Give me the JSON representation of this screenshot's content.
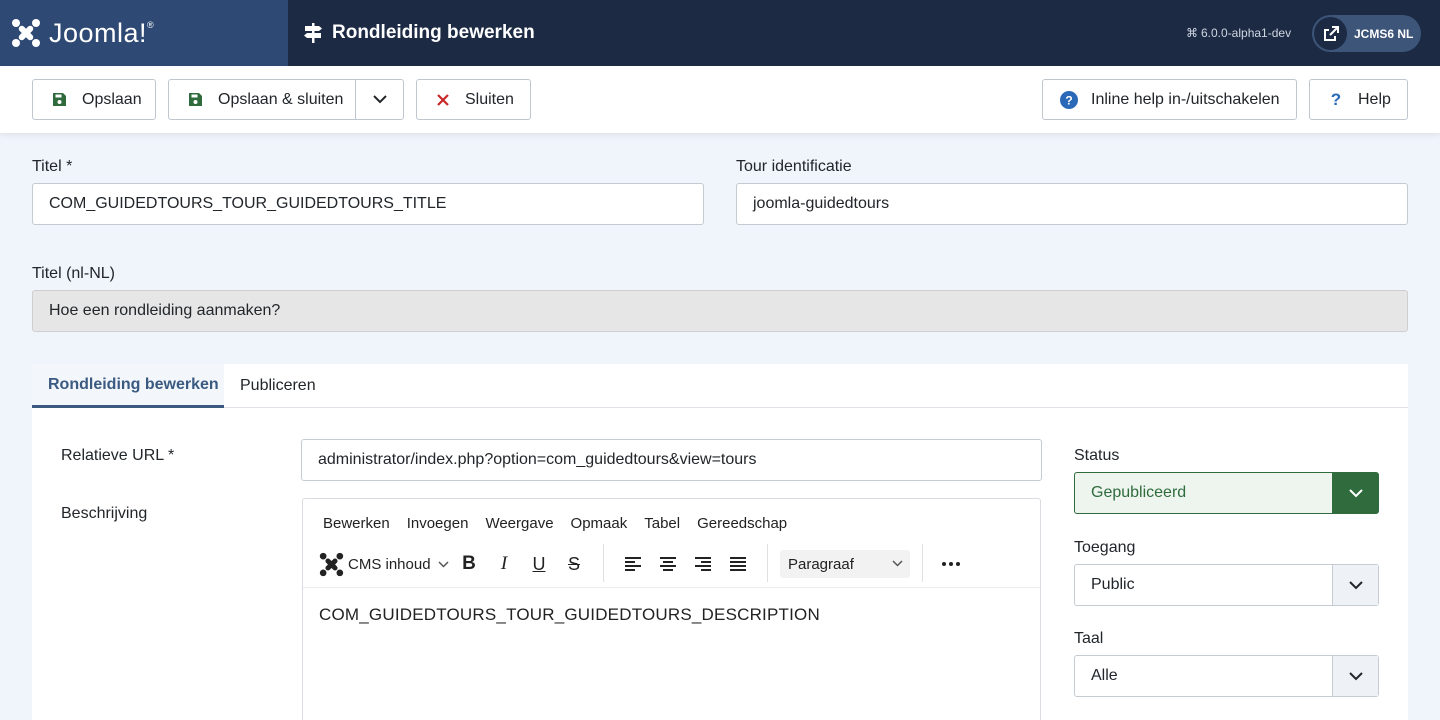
{
  "header": {
    "logo_text": "Joomla!",
    "page_title": "Rondleiding bewerken",
    "version": "6.0.0-alpha1-dev",
    "site_button": "JCMS6 NL"
  },
  "toolbar": {
    "save": "Opslaan",
    "save_close": "Opslaan & sluiten",
    "close": "Sluiten",
    "inline_help": "Inline help in-/uitschakelen",
    "help": "Help"
  },
  "form": {
    "title_label": "Titel *",
    "title_value": "COM_GUIDEDTOURS_TOUR_GUIDEDTOURS_TITLE",
    "tour_id_label": "Tour identificatie",
    "tour_id_value": "joomla-guidedtours",
    "title_lang_label": "Titel (nl-NL)",
    "title_lang_value": "Hoe een rondleiding aanmaken?"
  },
  "tabs": [
    {
      "label": "Rondleiding bewerken",
      "active": true
    },
    {
      "label": "Publiceren",
      "active": false
    }
  ],
  "main": {
    "url_label": "Relatieve URL *",
    "url_value": "administrator/index.php?option=com_guidedtours&view=tours",
    "description_label": "Beschrijving"
  },
  "editor": {
    "menu": [
      "Bewerken",
      "Invoegen",
      "Weergave",
      "Opmaak",
      "Tabel",
      "Gereedschap"
    ],
    "cms_content": "CMS inhoud",
    "paragraph": "Paragraaf",
    "content": "COM_GUIDEDTOURS_TOUR_GUIDEDTOURS_DESCRIPTION"
  },
  "sidebar": {
    "status_label": "Status",
    "status_value": "Gepubliceerd",
    "access_label": "Toegang",
    "access_value": "Public",
    "language_label": "Taal",
    "language_value": "Alle"
  },
  "colors": {
    "header_bg": "#1c2a44",
    "logo_bg": "#2e4a74",
    "accent": "#3a5a82",
    "status_green": "#2f6b3d",
    "save_green": "#2f6b3d",
    "close_red": "#c52827",
    "help_blue": "#2a69b8"
  }
}
